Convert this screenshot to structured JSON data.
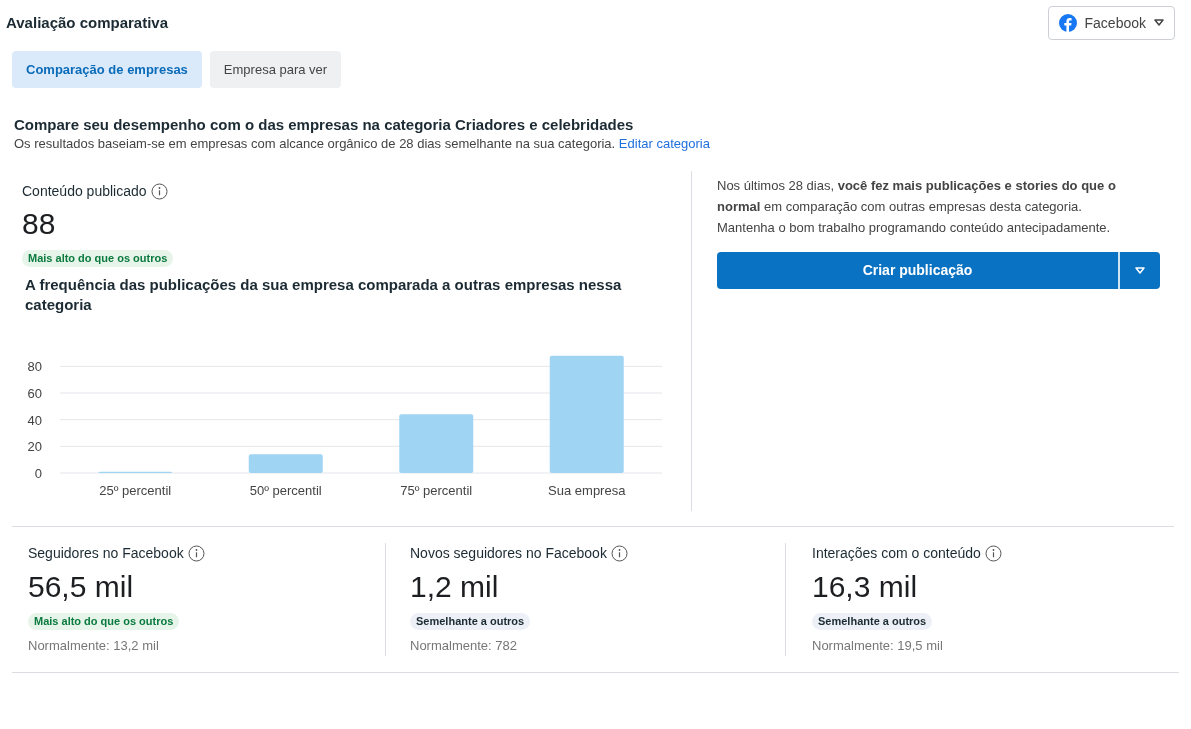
{
  "header": {
    "title": "Avaliação comparativa",
    "platform_select": {
      "label": "Facebook"
    }
  },
  "tabs": [
    {
      "label": "Comparação de empresas",
      "selected": true
    },
    {
      "label": "Empresa para ver",
      "selected": false
    }
  ],
  "intro": {
    "heading": "Compare seu desempenho com o das empresas na categoria Criadores e celebridades",
    "text": "Os resultados baseiam-se em empresas com alcance orgânico de 28 dias semelhante na sua categoria.",
    "link": "Editar categoria"
  },
  "published": {
    "label": "Conteúdo publicado",
    "value": "88",
    "badge": {
      "kind": "higher",
      "text": "Mais alto do que os outros"
    },
    "chart_title": "A frequência das publicações da sua empresa comparada a outras empresas nessa categoria",
    "chart_data": {
      "type": "bar",
      "categories": [
        "25º percentil",
        "50º percentil",
        "75º percentil",
        "Sua empresa"
      ],
      "values": [
        1,
        14,
        44,
        88
      ],
      "ylim": [
        0,
        90
      ],
      "grid": true,
      "yticks": [
        0,
        20,
        40,
        60,
        80
      ]
    }
  },
  "insight": {
    "text": "Nos últimos 28 dias, **você fez mais publicações e stories do que o normal** em comparação com outras empresas desta categoria. Mantenha o bom trabalho programando conteúdo antecipadamente.",
    "button": "Criar publicação"
  },
  "metrics": [
    {
      "label": "Seguidores no Facebook",
      "value": "56,5 mil",
      "badge": {
        "kind": "higher",
        "text": "Mais alto do que os outros"
      },
      "normal": "Normalmente: 13,2 mil"
    },
    {
      "label": "Novos seguidores no Facebook",
      "value": "1,2 mil",
      "badge": {
        "kind": "similar",
        "text": "Semelhante a outros"
      },
      "normal": "Normalmente: 782"
    },
    {
      "label": "Interações com o conteúdo",
      "value": "16,3 mil",
      "badge": {
        "kind": "similar",
        "text": "Semelhante a outros"
      },
      "normal": "Normalmente: 19,5 mil"
    }
  ]
}
